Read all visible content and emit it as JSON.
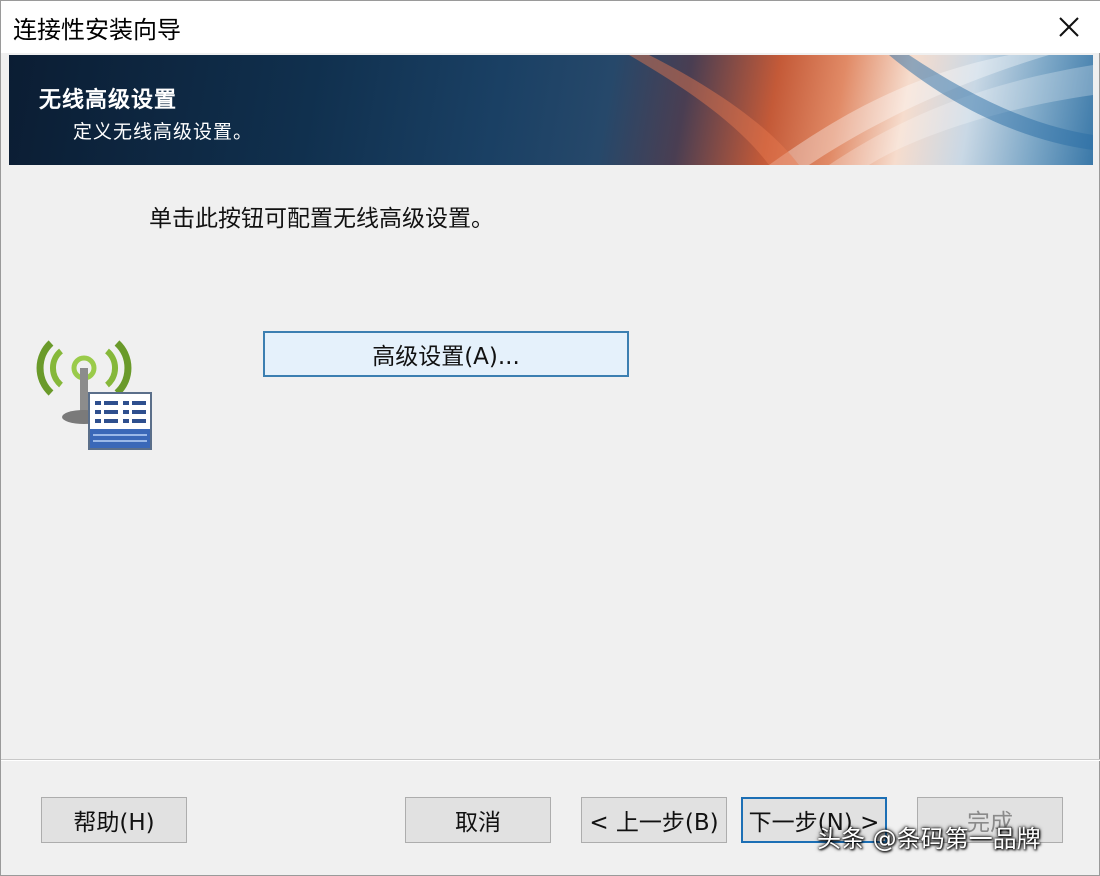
{
  "window": {
    "title": "连接性安装向导"
  },
  "banner": {
    "title": "无线高级设置",
    "subtitle": "定义无线高级设置。"
  },
  "content": {
    "instruction": "单击此按钮可配置无线高级设置。",
    "advanced_button_label": "高级设置(A)..."
  },
  "footer": {
    "help_label": "帮助(H)",
    "cancel_label": "取消",
    "back_label": "< 上一步(B)",
    "next_label": "下一步(N) >",
    "finish_label": "完成"
  },
  "watermark": {
    "text": "头条 @条码第一品牌"
  },
  "icons": {
    "close": "close-icon",
    "wireless": "wireless-settings-icon"
  },
  "colors": {
    "accent_border": "#3c7fb1",
    "button_face": "#e1e1e1",
    "banner_dark": "#0b1d33"
  }
}
